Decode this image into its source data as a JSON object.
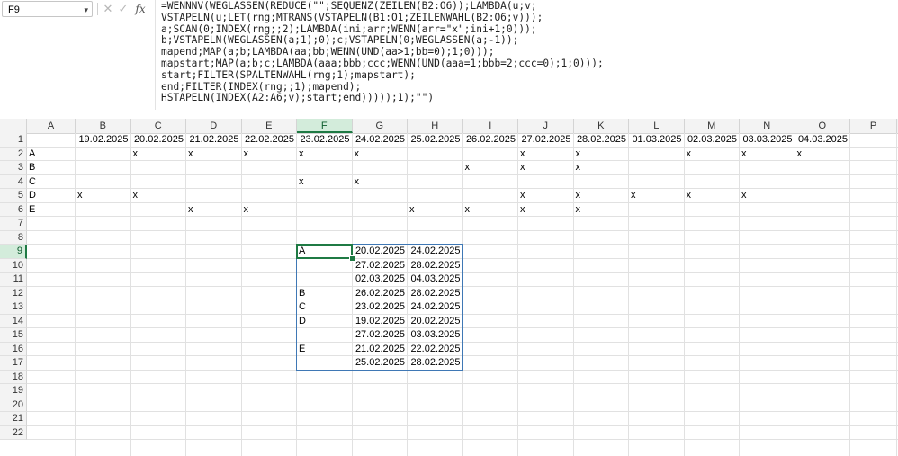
{
  "name_box": {
    "value": "F9",
    "dropdown_icon": "chevron-down-icon"
  },
  "formula_bar": {
    "cancel_icon": "x-icon",
    "enter_icon": "check-icon",
    "fx_label": "fx",
    "formula": "=WENNNV(WEGLASSEN(REDUCE(\"\";SEQUENZ(ZEILEN(B2:O6));LAMBDA(u;v;\nVSTAPELN(u;LET(rng;MTRANS(VSTAPELN(B1:O1;ZEILENWAHL(B2:O6;v)));\na;SCAN(0;INDEX(rng;;2);LAMBDA(ini;arr;WENN(arr=\"x\";ini+1;0)));\nb;VSTAPELN(WEGLASSEN(a;1);0);c;VSTAPELN(0;WEGLASSEN(a;-1));\nmapend;MAP(a;b;LAMBDA(aa;bb;WENN(UND(aa>1;bb=0);1;0)));\nmapstart;MAP(a;b;c;LAMBDA(aaa;bbb;ccc;WENN(UND(aaa=1;bbb=2;ccc=0);1;0)));\nstart;FILTER(SPALTENWAHL(rng;1);mapstart);\nend;FILTER(INDEX(rng;;1);mapend);\nHSTAPELN(INDEX(A2:A6;v);start;end)))));1);\"\")"
  },
  "sheet": {
    "active_cell": "F9",
    "columns": [
      "A",
      "B",
      "C",
      "D",
      "E",
      "F",
      "G",
      "H",
      "I",
      "J",
      "K",
      "L",
      "M",
      "N",
      "O",
      "P"
    ],
    "active_column": "F",
    "rows": [
      "1",
      "2",
      "3",
      "4",
      "5",
      "6",
      "7",
      "8",
      "9",
      "10",
      "11",
      "12",
      "13",
      "14",
      "15",
      "16",
      "17",
      "18",
      "19",
      "20",
      "21",
      "22"
    ],
    "active_row": "9",
    "header_dates": [
      "19.02.2025",
      "20.02.2025",
      "21.02.2025",
      "22.02.2025",
      "23.02.2025",
      "24.02.2025",
      "25.02.2025",
      "26.02.2025",
      "27.02.2025",
      "28.02.2025",
      "01.03.2025",
      "02.03.2025",
      "03.03.2025",
      "04.03.2025"
    ],
    "data_rows": [
      {
        "label": "A",
        "marks": [
          "",
          "x",
          "x",
          "x",
          "x",
          "x",
          "",
          "",
          "x",
          "x",
          "",
          "x",
          "x",
          "x"
        ]
      },
      {
        "label": "B",
        "marks": [
          "",
          "",
          "",
          "",
          "",
          "",
          "",
          "x",
          "x",
          "x",
          "",
          "",
          "",
          ""
        ]
      },
      {
        "label": "C",
        "marks": [
          "",
          "",
          "",
          "",
          "x",
          "x",
          "",
          "",
          "",
          "",
          "",
          "",
          "",
          ""
        ]
      },
      {
        "label": "D",
        "marks": [
          "x",
          "x",
          "",
          "",
          "",
          "",
          "",
          "",
          "x",
          "x",
          "x",
          "x",
          "x",
          ""
        ]
      },
      {
        "label": "E",
        "marks": [
          "",
          "",
          "x",
          "x",
          "",
          "",
          "x",
          "x",
          "x",
          "x",
          "",
          "",
          "",
          ""
        ]
      }
    ],
    "result_rows": [
      {
        "name": "A",
        "start": "20.02.2025",
        "end": "24.02.2025"
      },
      {
        "name": "",
        "start": "27.02.2025",
        "end": "28.02.2025"
      },
      {
        "name": "",
        "start": "02.03.2025",
        "end": "04.03.2025"
      },
      {
        "name": "B",
        "start": "26.02.2025",
        "end": "28.02.2025"
      },
      {
        "name": "C",
        "start": "23.02.2025",
        "end": "24.02.2025"
      },
      {
        "name": "D",
        "start": "19.02.2025",
        "end": "20.02.2025"
      },
      {
        "name": "",
        "start": "27.02.2025",
        "end": "03.03.2025"
      },
      {
        "name": "E",
        "start": "21.02.2025",
        "end": "22.02.2025"
      },
      {
        "name": "",
        "start": "25.02.2025",
        "end": "28.02.2025"
      }
    ]
  },
  "colors": {
    "accent_green": "#1f7a44",
    "result_border": "#3f78b5"
  }
}
